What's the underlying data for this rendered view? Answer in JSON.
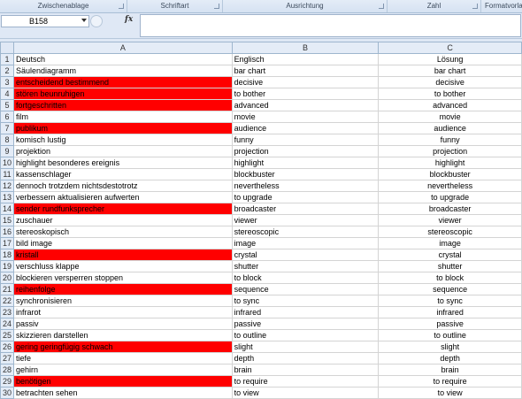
{
  "ribbon": {
    "groups": [
      "Zwischenablage",
      "Schriftart",
      "Ausrichtung",
      "Zahl",
      "Formatvorlagen"
    ]
  },
  "formula_bar": {
    "name_box": "B158",
    "fx_label": "fx",
    "content": ""
  },
  "columns": [
    "A",
    "B",
    "C"
  ],
  "rows": [
    {
      "n": "1",
      "a": "Deutsch",
      "b": "Englisch",
      "c": "Lösung",
      "red": false
    },
    {
      "n": "2",
      "a": "Säulendiagramm",
      "b": "bar chart",
      "c": "bar chart",
      "red": false
    },
    {
      "n": "3",
      "a": "entscheidend bestimmend",
      "b": "decisive",
      "c": "decisive",
      "red": true
    },
    {
      "n": "4",
      "a": "stören beunruhigen",
      "b": "to bother",
      "c": "to bother",
      "red": true
    },
    {
      "n": "5",
      "a": "fortgeschritten",
      "b": "advanced",
      "c": "advanced",
      "red": true
    },
    {
      "n": "6",
      "a": "film",
      "b": "movie",
      "c": "movie",
      "red": false
    },
    {
      "n": "7",
      "a": "publikum",
      "b": "audience",
      "c": "audience",
      "red": true
    },
    {
      "n": "8",
      "a": "komisch lustig",
      "b": "funny",
      "c": "funny",
      "red": false
    },
    {
      "n": "9",
      "a": "projektion",
      "b": "projection",
      "c": "projection",
      "red": false
    },
    {
      "n": "10",
      "a": "highlight besonderes ereignis",
      "b": "highlight",
      "c": "highlight",
      "red": false
    },
    {
      "n": "11",
      "a": "kassenschlager",
      "b": "blockbuster",
      "c": "blockbuster",
      "red": false
    },
    {
      "n": "12",
      "a": "dennoch trotzdem nichtsdestotrotz",
      "b": "nevertheless",
      "c": "nevertheless",
      "red": false
    },
    {
      "n": "13",
      "a": "verbessern aktualisieren aufwerten",
      "b": "to upgrade",
      "c": "to upgrade",
      "red": false
    },
    {
      "n": "14",
      "a": "sender rundfunksprecher",
      "b": "broadcaster",
      "c": "broadcaster",
      "red": true
    },
    {
      "n": "15",
      "a": "zuschauer",
      "b": "viewer",
      "c": "viewer",
      "red": false
    },
    {
      "n": "16",
      "a": "stereoskopisch",
      "b": "stereoscopic",
      "c": "stereoscopic",
      "red": false
    },
    {
      "n": "17",
      "a": "bild image",
      "b": "image",
      "c": "image",
      "red": false
    },
    {
      "n": "18",
      "a": "kristall",
      "b": "crystal",
      "c": "crystal",
      "red": true
    },
    {
      "n": "19",
      "a": "verschluss klappe",
      "b": "shutter",
      "c": "shutter",
      "red": false
    },
    {
      "n": "20",
      "a": "blockieren versperren stoppen",
      "b": "to block",
      "c": "to block",
      "red": false
    },
    {
      "n": "21",
      "a": "reihenfolge",
      "b": "sequence",
      "c": "sequence",
      "red": true
    },
    {
      "n": "22",
      "a": "synchronisieren",
      "b": "to sync",
      "c": "to sync",
      "red": false
    },
    {
      "n": "23",
      "a": "infrarot",
      "b": "infrared",
      "c": "infrared",
      "red": false
    },
    {
      "n": "24",
      "a": "passiv",
      "b": "passive",
      "c": "passive",
      "red": false
    },
    {
      "n": "25",
      "a": "skizzieren darstellen",
      "b": "to outline",
      "c": "to outline",
      "red": false
    },
    {
      "n": "26",
      "a": "gering geringfügig schwach",
      "b": "slight",
      "c": "slight",
      "red": true
    },
    {
      "n": "27",
      "a": "tiefe",
      "b": "depth",
      "c": "depth",
      "red": false
    },
    {
      "n": "28",
      "a": "gehirn",
      "b": "brain",
      "c": "brain",
      "red": false
    },
    {
      "n": "29",
      "a": "benötigen",
      "b": "to require",
      "c": "to require",
      "red": true
    },
    {
      "n": "30",
      "a": "betrachten sehen",
      "b": "to view",
      "c": "to view",
      "red": false
    }
  ],
  "colors": {
    "highlight": "#ff0000",
    "header_bg": "#e4ecf7"
  }
}
